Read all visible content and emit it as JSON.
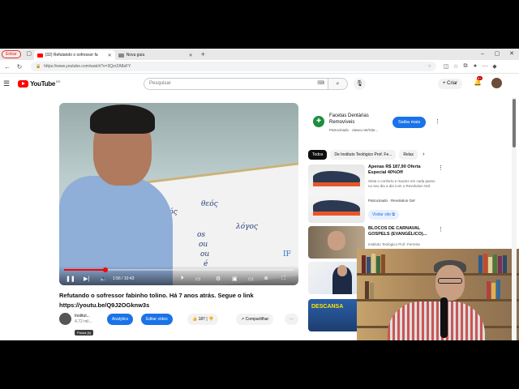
{
  "browser": {
    "sign_in": "Entrar",
    "tabs": [
      {
        "title": "(32) Refutando o sofressor fa",
        "active": true
      },
      {
        "title": "Nova guia",
        "active": false
      }
    ],
    "new_tab": "+",
    "url": "https://www.youtube.com/watch?v=3QzrZA8sFY"
  },
  "youtube": {
    "logo": "YouTube",
    "logo_region": "BR",
    "search_placeholder": "Pesquisar",
    "create_label": "Criar",
    "notif_count": "9+"
  },
  "video": {
    "title": "Refutando o sofressor fabinho tolino. Há 7 anos atrás. Segue o link https://youtu.be/Q9J2OGknw3s",
    "time": "1:56 / 10:43",
    "progress_fraction": 0.18,
    "tooltip": "Pausa (k)",
    "board_words": [
      "θεός",
      "θεός",
      "λόγος",
      "os",
      "ou",
      "ou",
      "é"
    ],
    "watermark": "IF"
  },
  "channel": {
    "name": "Institut...",
    "subs": "4,72 mil..."
  },
  "actions": {
    "analytics": "Analytics",
    "edit": "Editar vídeo",
    "likes": "187",
    "share": "Compartilhar"
  },
  "ad": {
    "title": "Facetas Dentárias Removíveis",
    "sponsor": "Patrocinado · otewo.net/Site...",
    "button": "Saiba mais"
  },
  "chips": [
    "Todos",
    "De Instituto Teológico Prof. Fe...",
    "Relac"
  ],
  "recs": [
    {
      "title": "Apenas R$ 187,90 Oferta Especial 40%Off",
      "desc": "Sinta o conforto e maciez em cada passo no seu dia a dia com o Revolution Gel.",
      "meta": "Patrocinado · Revolution Gel",
      "visit": "Visitar site"
    },
    {
      "title": "BLOCOS DE CARNAVAL GOSPELS (EVANGÉLICO)...",
      "meta": "Instituto Teológico Prof. Ferreira"
    }
  ],
  "thumb_text": "DESCANSA",
  "colors": {
    "accent": "#1a73e8",
    "brand": "#ff0000"
  }
}
